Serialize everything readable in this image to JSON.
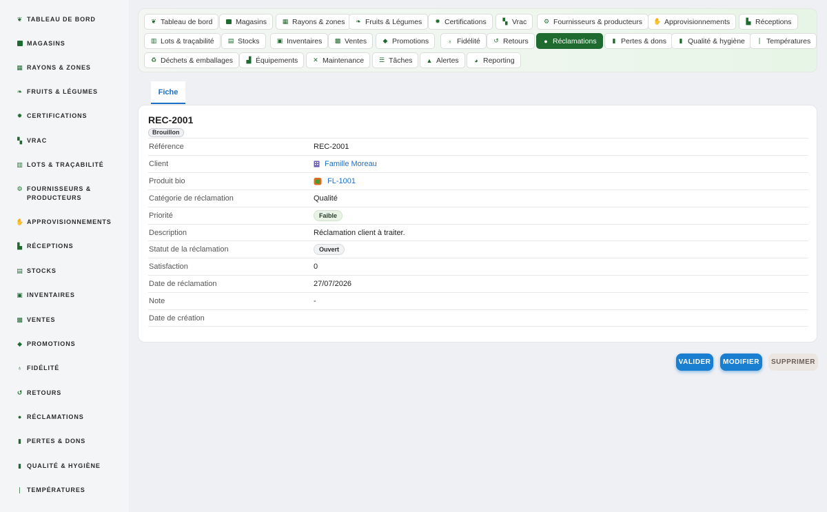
{
  "sidebar": {
    "items": [
      {
        "label": "Tableau de bord",
        "icon": "sprout-icon"
      },
      {
        "label": "Magasins",
        "icon": "store-icon"
      },
      {
        "label": "Rayons & zones",
        "icon": "grid-icon"
      },
      {
        "label": "Fruits & Légumes",
        "icon": "leaf-icon"
      },
      {
        "label": "Certifications",
        "icon": "certificate-icon"
      },
      {
        "label": "Vrac",
        "icon": "boxes-icon"
      },
      {
        "label": "Lots & traçabilité",
        "icon": "barcode-icon"
      },
      {
        "label": "Fournisseurs & producteurs",
        "icon": "tractor-icon"
      },
      {
        "label": "Approvisionnements",
        "icon": "hand-holding-icon"
      },
      {
        "label": "Réceptions",
        "icon": "truck-icon"
      },
      {
        "label": "Stocks",
        "icon": "warehouse-icon"
      },
      {
        "label": "Inventaires",
        "icon": "clipboard-check-icon"
      },
      {
        "label": "Ventes",
        "icon": "cash-register-icon"
      },
      {
        "label": "Promotions",
        "icon": "tags-icon"
      },
      {
        "label": "Fidélité",
        "icon": "award-icon"
      },
      {
        "label": "Retours",
        "icon": "undo-icon"
      },
      {
        "label": "Réclamations",
        "icon": "comment-icon"
      },
      {
        "label": "Pertes & dons",
        "icon": "trash-icon"
      },
      {
        "label": "Qualité & hygiène",
        "icon": "pump-soap-icon"
      },
      {
        "label": "Températures",
        "icon": "thermometer-icon"
      }
    ]
  },
  "topnav": {
    "chips": [
      {
        "label": "Tableau de bord",
        "icon": "sprout-icon"
      },
      {
        "label": "Magasins",
        "icon": "store-icon"
      },
      {
        "label": "Rayons & zones",
        "icon": "grid-icon"
      },
      {
        "label": "Fruits & Légumes",
        "icon": "leaf-icon"
      },
      {
        "label": "Certifications",
        "icon": "certificate-icon"
      },
      {
        "label": "Vrac",
        "icon": "boxes-icon"
      },
      {
        "label": "Fournisseurs & producteurs",
        "icon": "tractor-icon"
      },
      {
        "label": "Approvisionnements",
        "icon": "hand-holding-icon"
      },
      {
        "label": "Réceptions",
        "icon": "truck-icon"
      },
      {
        "label": "Lots & traçabilité",
        "icon": "barcode-icon"
      },
      {
        "label": "Stocks",
        "icon": "warehouse-icon"
      },
      {
        "label": "Inventaires",
        "icon": "clipboard-check-icon"
      },
      {
        "label": "Ventes",
        "icon": "cash-register-icon"
      },
      {
        "label": "Promotions",
        "icon": "tags-icon"
      },
      {
        "label": "Fidélité",
        "icon": "award-icon"
      },
      {
        "label": "Retours",
        "icon": "undo-icon"
      },
      {
        "label": "Réclamations",
        "icon": "comment-icon",
        "active": true
      },
      {
        "label": "Pertes & dons",
        "icon": "trash-icon"
      },
      {
        "label": "Qualité & hygiène",
        "icon": "pump-soap-icon"
      },
      {
        "label": "Températures",
        "icon": "thermometer-icon"
      },
      {
        "label": "Déchets & emballages",
        "icon": "recycle-icon"
      },
      {
        "label": "Équipements",
        "icon": "toolbox-icon"
      },
      {
        "label": "Maintenance",
        "icon": "tools-icon"
      },
      {
        "label": "Tâches",
        "icon": "list-icon"
      },
      {
        "label": "Alertes",
        "icon": "bell-icon"
      },
      {
        "label": "Reporting",
        "icon": "pie-chart-icon"
      }
    ]
  },
  "tabs": [
    {
      "label": "Fiche",
      "active": true
    }
  ],
  "record": {
    "title": "REC-2001",
    "status_badge": "Brouillon",
    "fields": [
      {
        "label": "Référence",
        "value": "REC-2001"
      },
      {
        "label": "Client",
        "value": "Famille Moreau",
        "link": true,
        "icon": "building-icon"
      },
      {
        "label": "Produit bio",
        "value": "FL-1001",
        "link": true,
        "icon": "apple-icon"
      },
      {
        "label": "Catégorie de réclamation",
        "value": "Qualité"
      },
      {
        "label": "Priorité",
        "value": "Faible",
        "pill": "low"
      },
      {
        "label": "Description",
        "value": "Réclamation client à traiter."
      },
      {
        "label": "Statut de la réclamation",
        "value": "Ouvert",
        "pill": "open"
      },
      {
        "label": "Satisfaction",
        "value": "0"
      },
      {
        "label": "Date de réclamation",
        "value": "27/07/2026"
      },
      {
        "label": "Note",
        "value": "-",
        "muted": true
      },
      {
        "label": "Date de création",
        "value": ""
      }
    ]
  },
  "actions": {
    "validate": "Valider",
    "edit": "Modifier",
    "delete": "Supprimer"
  },
  "colors": {
    "accent_green": "#1f6b2f",
    "accent_blue": "#1a7fd1"
  }
}
